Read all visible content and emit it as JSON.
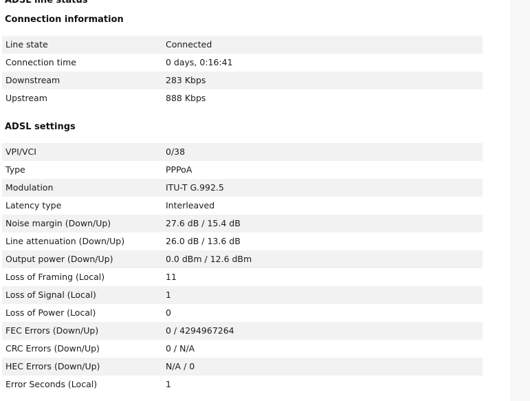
{
  "page_title": "ADSL line status",
  "connection": {
    "heading": "Connection information",
    "rows": [
      {
        "label": "Line state",
        "value": "Connected"
      },
      {
        "label": "Connection time",
        "value": "0 days, 0:16:41"
      },
      {
        "label": "Downstream",
        "value": "283 Kbps"
      },
      {
        "label": "Upstream",
        "value": "888 Kbps"
      }
    ]
  },
  "settings": {
    "heading": "ADSL settings",
    "rows": [
      {
        "label": "VPI/VCI",
        "value": "0/38"
      },
      {
        "label": "Type",
        "value": "PPPoA"
      },
      {
        "label": "Modulation",
        "value": "ITU-T G.992.5"
      },
      {
        "label": "Latency type",
        "value": "Interleaved"
      },
      {
        "label": "Noise margin (Down/Up)",
        "value": "27.6 dB / 15.4 dB"
      },
      {
        "label": "Line attenuation (Down/Up)",
        "value": "26.0 dB / 13.6 dB"
      },
      {
        "label": "Output power (Down/Up)",
        "value": "0.0 dBm / 12.6 dBm"
      },
      {
        "label": "Loss of Framing (Local)",
        "value": "11"
      },
      {
        "label": "Loss of Signal (Local)",
        "value": "1"
      },
      {
        "label": "Loss of Power (Local)",
        "value": "0"
      },
      {
        "label": "FEC Errors (Down/Up)",
        "value": "0 / 4294967264"
      },
      {
        "label": "CRC Errors (Down/Up)",
        "value": "0 / N/A"
      },
      {
        "label": "HEC Errors (Down/Up)",
        "value": "N/A / 0"
      },
      {
        "label": "Error Seconds (Local)",
        "value": "1"
      }
    ]
  }
}
